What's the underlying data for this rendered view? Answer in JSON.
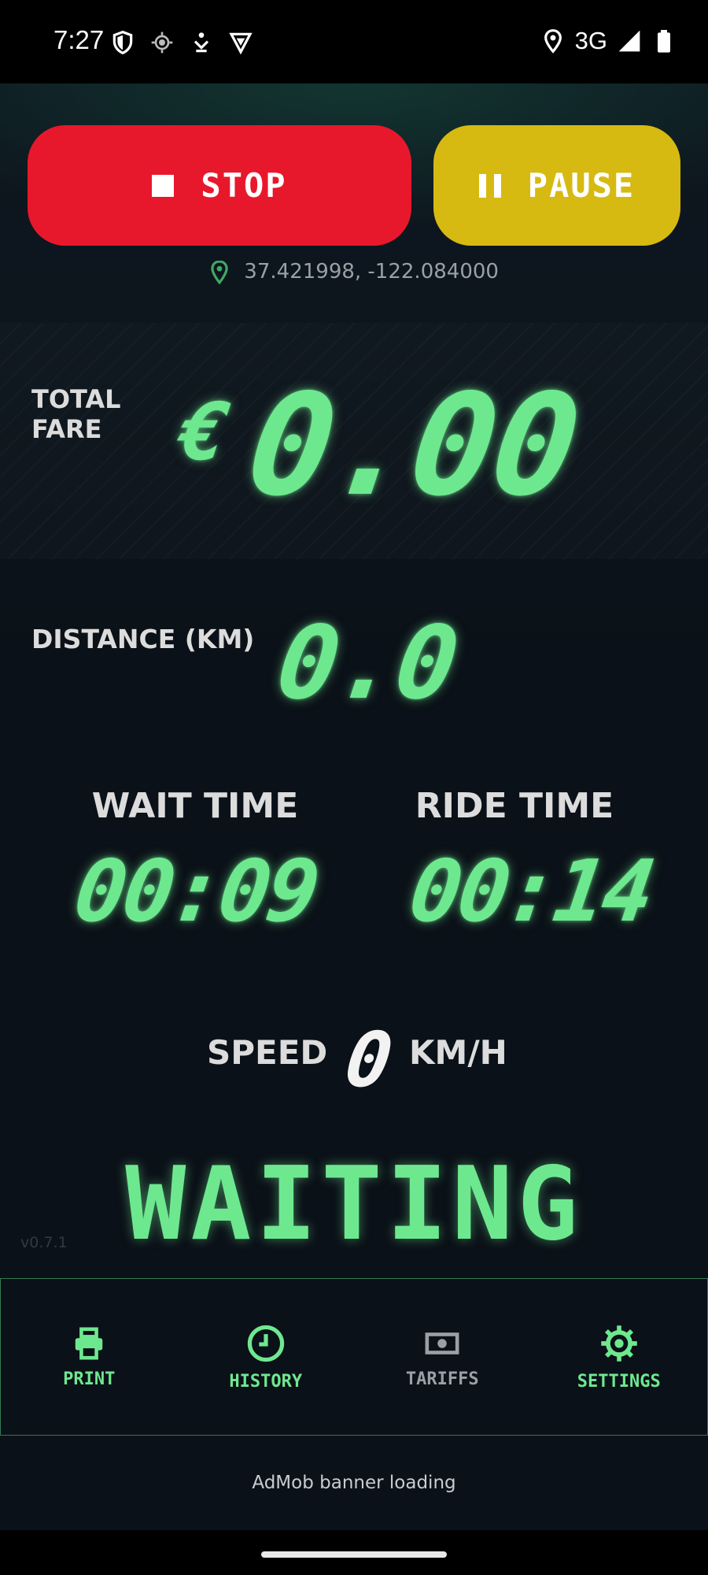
{
  "status_bar": {
    "time": "7:27",
    "network": "3G",
    "left_icons": [
      "shield-icon",
      "crosshair-icon",
      "download-icon",
      "vpn-icon"
    ],
    "right_icons": [
      "location-icon",
      "signal-icon",
      "battery-icon"
    ]
  },
  "controls": {
    "stop_label": "STOP",
    "pause_label": "PAUSE",
    "stop_color": "#e8182c",
    "pause_color": "#d6ba12"
  },
  "location": {
    "coords": "37.421998, -122.084000"
  },
  "meter": {
    "fare_label_line1": "TOTAL",
    "fare_label_line2": "FARE",
    "currency": "€",
    "fare_value": "0.00",
    "distance_label": "DISTANCE (KM)",
    "distance_value": "0.0",
    "wait_label": "WAIT TIME",
    "wait_value": "00:09",
    "ride_label": "RIDE TIME",
    "ride_value": "00:14",
    "speed_label": "SPEED",
    "speed_value": "0",
    "speed_unit": "KM/H",
    "status": "WAITING",
    "accent_color": "#6ee88f"
  },
  "version": "v0.7.1",
  "nav": {
    "items": [
      {
        "label": "PRINT",
        "icon": "printer-icon",
        "active": true
      },
      {
        "label": "HISTORY",
        "icon": "clock-icon",
        "active": true
      },
      {
        "label": "TARIFFS",
        "icon": "banknote-icon",
        "active": false
      },
      {
        "label": "SETTINGS",
        "icon": "gear-icon",
        "active": true
      }
    ]
  },
  "ad": {
    "text": "AdMob banner loading"
  }
}
